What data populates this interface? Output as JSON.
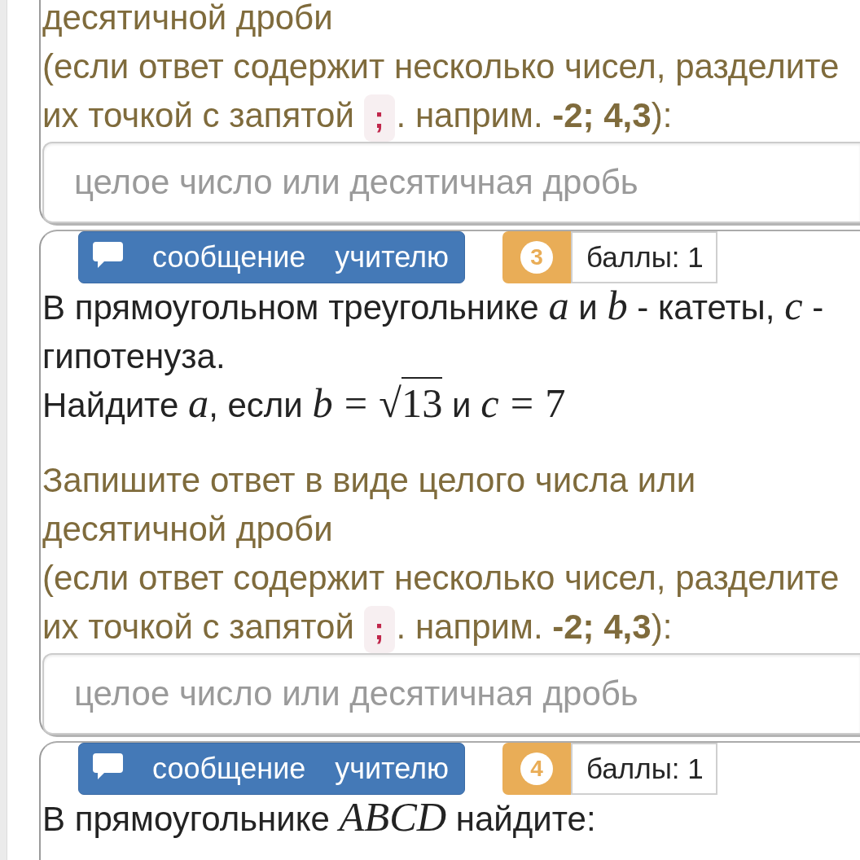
{
  "cards": [
    {
      "instruction": [
        [
          {
            "kind": "text",
            "text": "десятичной дроби"
          }
        ],
        [
          {
            "kind": "text",
            "text": "(если ответ содержит несколько чисел, разделите их точкой с запятой "
          },
          {
            "kind": "code",
            "text": ";"
          },
          {
            "kind": "text",
            "text": ". наприм. **-2; 4,3**):"
          }
        ]
      ],
      "answer": {
        "placeholder": "целое число или десятичная дробь"
      }
    },
    {
      "message_button": "сообщение учителю",
      "number": "3",
      "points": "баллы: 1",
      "question": [
        [
          {
            "kind": "text",
            "text": "В прямоугольном треугольнике "
          },
          {
            "kind": "var",
            "text": "a"
          },
          {
            "kind": "text",
            "text": " и "
          },
          {
            "kind": "var",
            "text": "b"
          },
          {
            "kind": "text",
            "text": " - катеты, "
          },
          {
            "kind": "var",
            "text": "c"
          },
          {
            "kind": "text",
            "text": " - гипотенуза."
          }
        ],
        [
          {
            "kind": "text",
            "text": "Найдите "
          },
          {
            "kind": "var",
            "text": "a"
          },
          {
            "kind": "text",
            "text": ", если "
          },
          {
            "kind": "var",
            "text": "b"
          },
          {
            "kind": "rel",
            "text": "="
          },
          {
            "kind": "radical",
            "text": "√"
          },
          {
            "kind": "radicand",
            "text": "13"
          },
          {
            "kind": "text",
            "text": " и "
          },
          {
            "kind": "var",
            "text": "c"
          },
          {
            "kind": "rel",
            "text": "="
          },
          {
            "kind": "num",
            "text": "7"
          }
        ]
      ],
      "instruction": [
        [
          {
            "kind": "text",
            "text": "Запишите ответ в виде целого числа или десятичной дроби"
          }
        ],
        [
          {
            "kind": "text",
            "text": "(если ответ содержит несколько чисел, разделите их точкой с запятой "
          },
          {
            "kind": "code",
            "text": ";"
          },
          {
            "kind": "text",
            "text": ". наприм. **-2; 4,3**):"
          }
        ]
      ],
      "answer": {
        "placeholder": "целое число или десятичная дробь"
      }
    },
    {
      "message_button": "сообщение учителю",
      "number": "4",
      "points": "баллы: 1",
      "question": [
        [
          {
            "kind": "text",
            "text": "В прямоугольнике "
          },
          {
            "kind": "var",
            "text": "ABCD"
          },
          {
            "kind": "text",
            "text": " найдите:"
          }
        ]
      ]
    }
  ]
}
